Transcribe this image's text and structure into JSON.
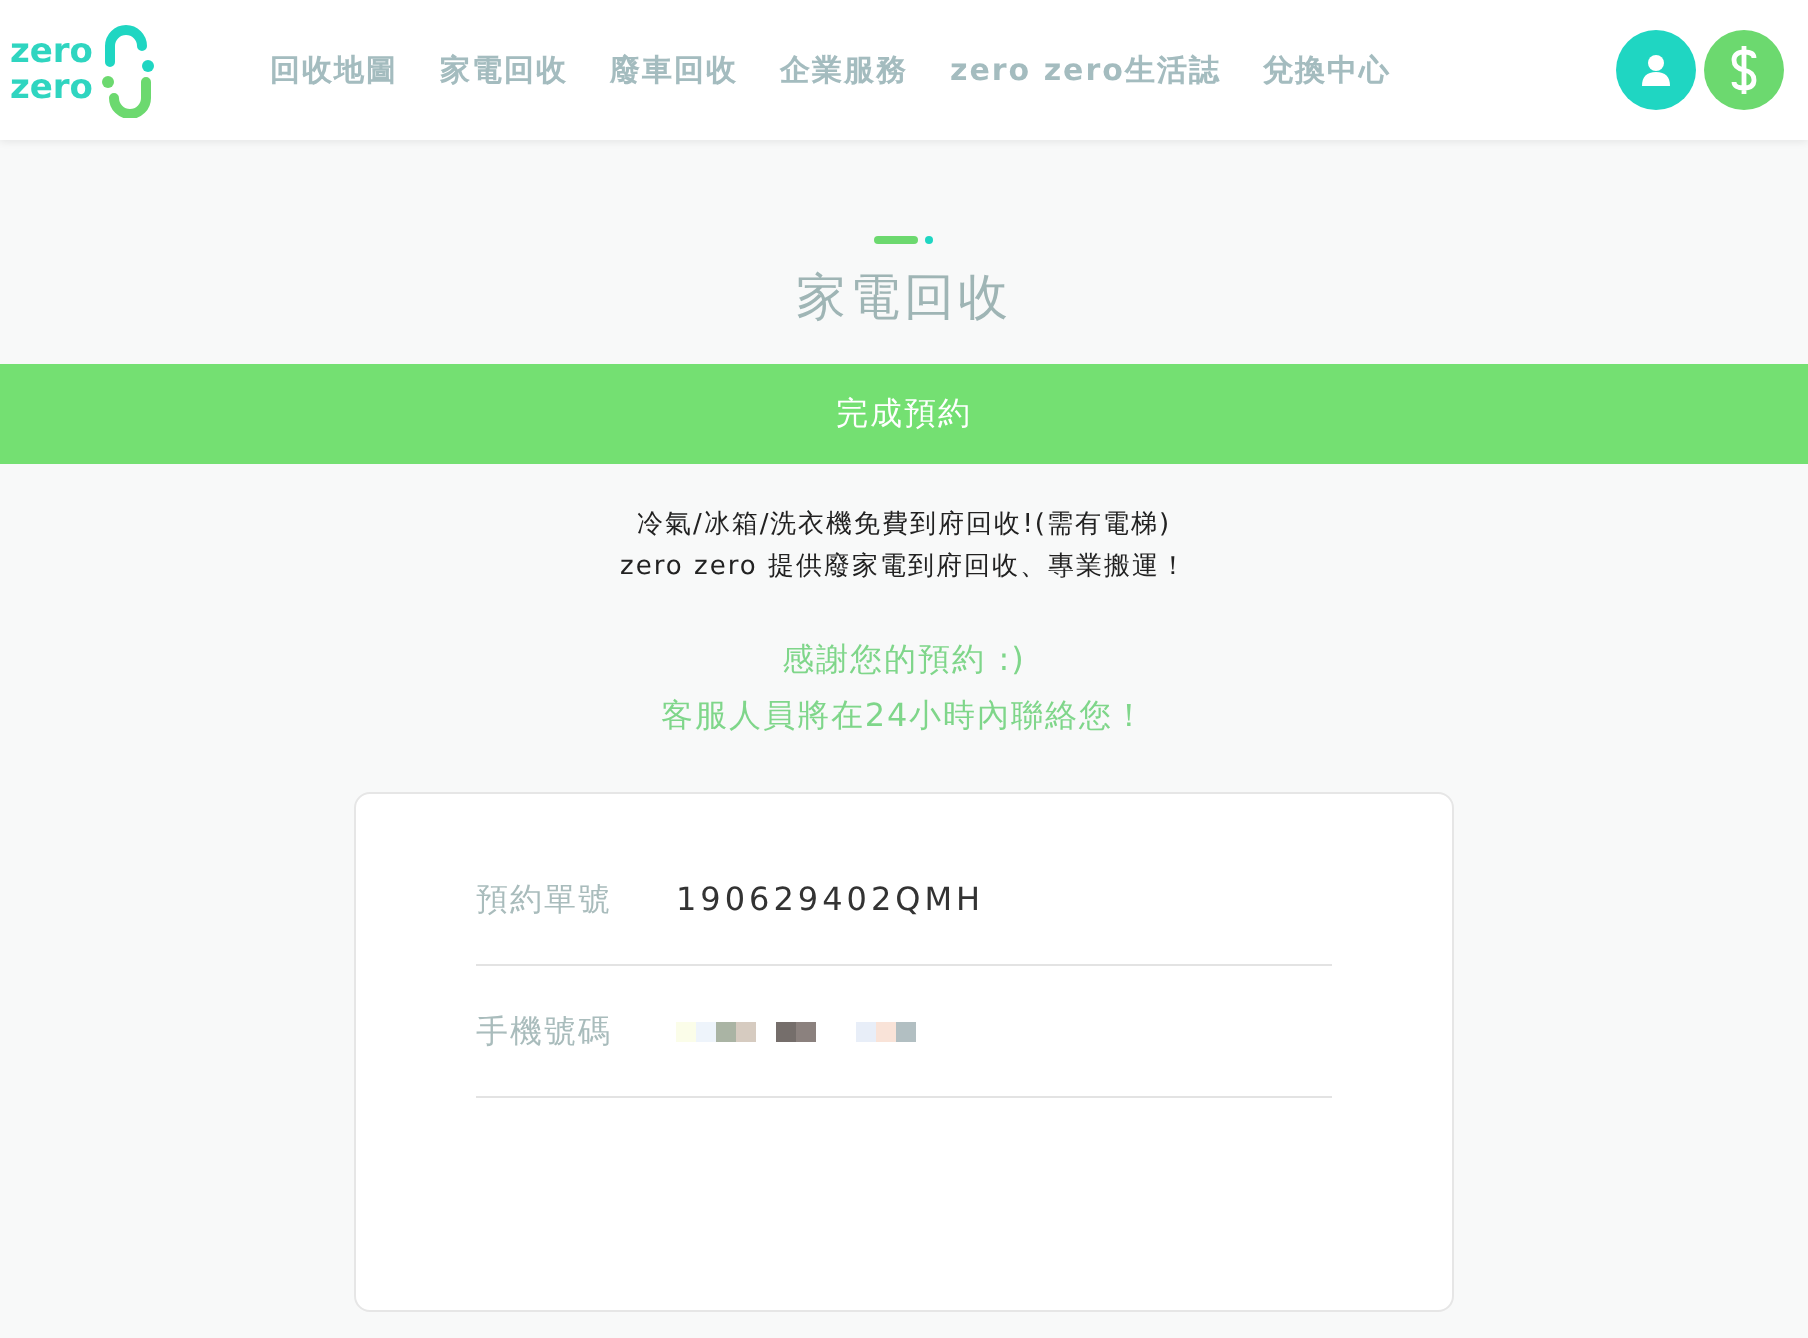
{
  "header": {
    "logo": [
      "zero",
      "zero"
    ],
    "nav": [
      "回收地圖",
      "家電回收",
      "廢車回收",
      "企業服務",
      "zero zero生活誌",
      "兌換中心"
    ]
  },
  "page_title": "家電回收",
  "banner": "完成預約",
  "intro": [
    "冷氣/冰箱/洗衣機免費到府回收!(需有電梯)",
    "zero zero 提供廢家電到府回收、專業搬運！"
  ],
  "thanks": [
    "感謝您的預約 :)",
    "客服人員將在24小時內聯絡您！"
  ],
  "details": [
    {
      "kind": "text",
      "label": "預約單號",
      "value": "190629402QMH"
    },
    {
      "kind": "redacted",
      "label": "手機號碼"
    }
  ]
}
